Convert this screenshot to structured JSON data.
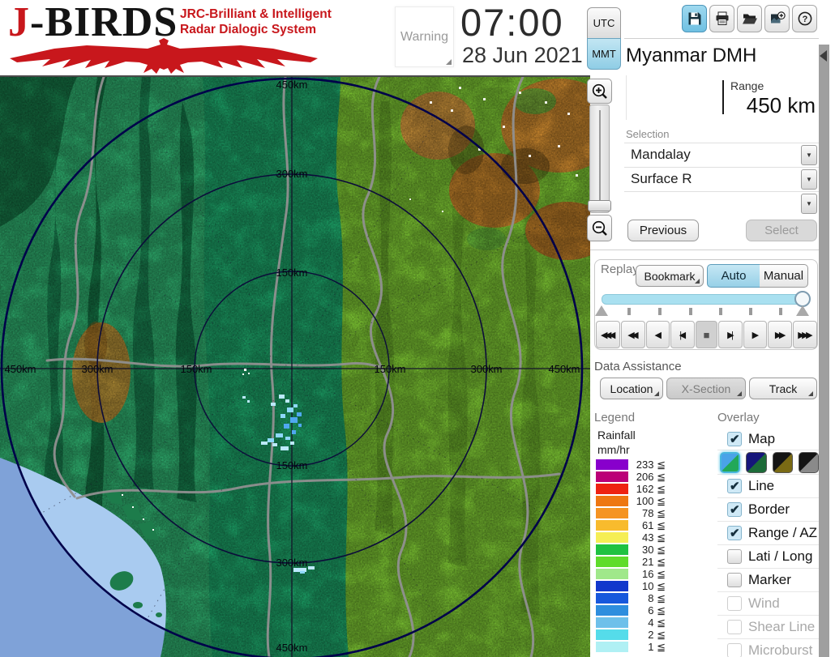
{
  "header": {
    "logo": {
      "j": "J",
      "birds": "-BIRDS",
      "sub1": "JRC-Brilliant & Intelligent",
      "sub2": "Radar  Dialogic  System"
    },
    "warning_label": "Warning",
    "time": "07:00",
    "date": "28 Jun 2021",
    "tz_utc": "UTC",
    "tz_mmt": "MMT",
    "tz_selected": "MMT",
    "toolbar_icons": [
      "save-icon",
      "print-icon",
      "open-folder-icon",
      "snapshot-add-icon",
      "help-icon"
    ]
  },
  "station": {
    "name": "Myanmar DMH",
    "range_label": "Range",
    "range_value": "450 km"
  },
  "selection": {
    "label": "Selection",
    "dropdowns": [
      {
        "value": "Mandalay"
      },
      {
        "value": "Surface R"
      },
      {
        "value": ""
      }
    ],
    "previous_label": "Previous",
    "select_label": "Select"
  },
  "replay": {
    "label": "Replay",
    "bookmark_label": "Bookmark",
    "auto_label": "Auto",
    "manual_label": "Manual",
    "selected_mode": "Auto",
    "playback": [
      {
        "name": "rewind-fast-button",
        "glyph": "◀◀◀",
        "pressed": false
      },
      {
        "name": "rewind-button",
        "glyph": "◀◀",
        "pressed": false
      },
      {
        "name": "play-reverse-button",
        "glyph": "◀",
        "pressed": false
      },
      {
        "name": "step-back-button",
        "glyph": "|◀",
        "pressed": false
      },
      {
        "name": "stop-button",
        "glyph": "■",
        "pressed": true
      },
      {
        "name": "step-forward-button",
        "glyph": "▶|",
        "pressed": false
      },
      {
        "name": "play-button",
        "glyph": "▶",
        "pressed": false
      },
      {
        "name": "forward-button",
        "glyph": "▶▶",
        "pressed": false
      },
      {
        "name": "forward-fast-button",
        "glyph": "▶▶▶",
        "pressed": false
      }
    ]
  },
  "data_assistance": {
    "label": "Data Assistance",
    "buttons": [
      {
        "label": "Location",
        "state": "normal"
      },
      {
        "label": "X-Section",
        "state": "active"
      },
      {
        "label": "Track",
        "state": "normal"
      }
    ]
  },
  "legend": {
    "label": "Legend",
    "unit1": "Rainfall",
    "unit2": "mm/hr",
    "entries": [
      {
        "value": "233 ≦",
        "color": "#8800cc"
      },
      {
        "value": "206 ≦",
        "color": "#bb0077"
      },
      {
        "value": "162 ≦",
        "color": "#ee2211"
      },
      {
        "value": "100 ≦",
        "color": "#ee7711"
      },
      {
        "value": "78 ≦",
        "color": "#f59422"
      },
      {
        "value": "61 ≦",
        "color": "#f8bb2d"
      },
      {
        "value": "43 ≦",
        "color": "#f5ee55"
      },
      {
        "value": "30 ≦",
        "color": "#1fc241"
      },
      {
        "value": "21 ≦",
        "color": "#5fdc2a"
      },
      {
        "value": "16 ≦",
        "color": "#a0e88a"
      },
      {
        "value": "10 ≦",
        "color": "#1238cc"
      },
      {
        "value": "8 ≦",
        "color": "#1758dc"
      },
      {
        "value": "6 ≦",
        "color": "#2e8ede"
      },
      {
        "value": "4 ≦",
        "color": "#6ec0ea"
      },
      {
        "value": "2 ≦",
        "color": "#55dcea"
      },
      {
        "value": "1 ≦",
        "color": "#b0f0f4"
      }
    ]
  },
  "overlay": {
    "label": "Overlay",
    "map_item": {
      "label": "Map",
      "checked": true
    },
    "map_styles": [
      {
        "name": "map-style-light",
        "css": "linear-gradient(135deg,#4aa3e8 49%,#22a858 51%)",
        "selected": true
      },
      {
        "name": "map-style-dark-blue",
        "css": "linear-gradient(135deg,#15157a 49%,#1c6b38 51%)",
        "selected": false
      },
      {
        "name": "map-style-olive",
        "css": "linear-gradient(135deg,#141414 49%,#7a6a14 51%)",
        "selected": false
      },
      {
        "name": "map-style-gray",
        "css": "linear-gradient(135deg,#141414 49%,#8a8a8a 51%)",
        "selected": false
      }
    ],
    "items": [
      {
        "label": "Line",
        "checked": true,
        "disabled": false
      },
      {
        "label": "Border",
        "checked": true,
        "disabled": false
      },
      {
        "label": "Range / AZ",
        "checked": true,
        "disabled": false
      },
      {
        "label": "Lati / Long",
        "checked": false,
        "disabled": false
      },
      {
        "label": "Marker",
        "checked": false,
        "disabled": false
      },
      {
        "label": "Wind",
        "checked": false,
        "disabled": true
      },
      {
        "label": "Shear Line",
        "checked": false,
        "disabled": true
      },
      {
        "label": "Microburst",
        "checked": false,
        "disabled": true
      }
    ]
  },
  "map": {
    "rings_km": [
      150,
      300,
      450
    ],
    "labels": [
      {
        "text": "450km"
      },
      {
        "text": "300km"
      },
      {
        "text": "150km"
      },
      {
        "text": "150km"
      },
      {
        "text": "300km"
      },
      {
        "text": "450km"
      },
      {
        "text": "450km"
      },
      {
        "text": "300km"
      },
      {
        "text": "150km"
      },
      {
        "text": "150km"
      },
      {
        "text": "300km"
      },
      {
        "text": "450km"
      }
    ]
  },
  "icons": {
    "zoom_in": "zoom-in-icon",
    "zoom_out": "zoom-out-icon",
    "dropdown_arrow": "chevron-down-icon",
    "collapse": "collapse-panel-icon"
  }
}
